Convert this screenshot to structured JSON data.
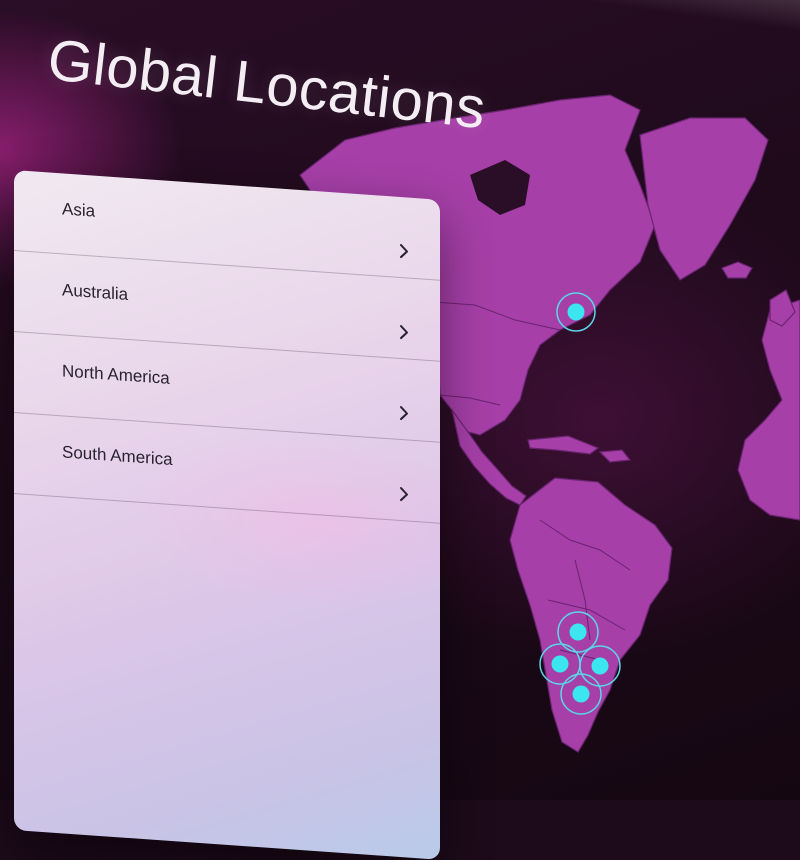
{
  "page": {
    "title": "Global Locations"
  },
  "regions": [
    {
      "label": "Asia",
      "icon": "chevron-right-icon"
    },
    {
      "label": "Australia",
      "icon": "chevron-right-icon"
    },
    {
      "label": "North America",
      "icon": "chevron-right-icon"
    },
    {
      "label": "South America",
      "icon": "chevron-right-icon"
    }
  ],
  "map": {
    "land_color": "#a63fa8",
    "border_color": "#6a2470",
    "marker_color": "#3ce6f0",
    "marker_ring_color": "#5ad8e8",
    "markers": [
      {
        "name": "north-america-marker"
      },
      {
        "name": "south-america-marker-1"
      },
      {
        "name": "south-america-marker-2"
      },
      {
        "name": "south-america-marker-3"
      },
      {
        "name": "south-america-marker-4"
      }
    ]
  },
  "colors": {
    "background": "#1d0a1a",
    "title_text": "#f5edf4",
    "list_text": "#2a2230"
  }
}
